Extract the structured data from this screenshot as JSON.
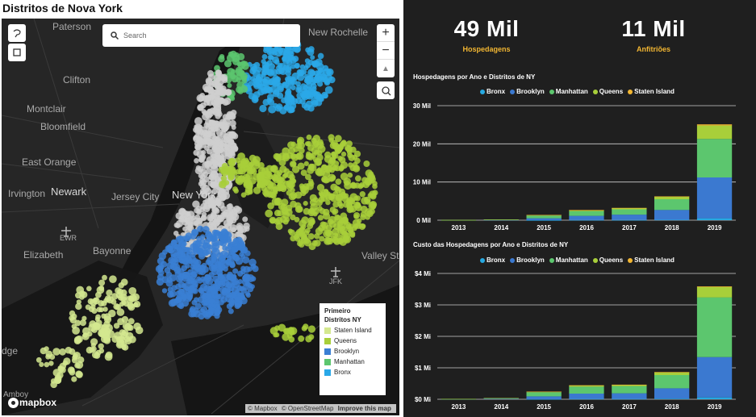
{
  "map": {
    "title": "Distritos de Nova York",
    "search_placeholder": "Search",
    "zoom_in": "+",
    "zoom_out": "−",
    "compass": "▲",
    "labels": {
      "paterson": "Paterson",
      "new_rochelle": "New Rochelle",
      "clifton": "Clifton",
      "montclair": "Montclair",
      "bloomfield": "Bloomfield",
      "east_orange": "East Orange",
      "irvington": "Irvington",
      "newark": "Newark",
      "jersey_city": "Jersey City",
      "new_york": "New York",
      "ewr": "EWR",
      "elizabeth": "Elizabeth",
      "bayonne": "Bayonne",
      "jfk": "JFK",
      "valley_stre": "Valley Stre",
      "dge": "dge",
      "amboy": "Amboy"
    },
    "legend": {
      "header1": "Primeiro",
      "header2": "Distritos NY",
      "items": [
        {
          "label": "Staten Island",
          "color": "#d4e88f"
        },
        {
          "label": "Queens",
          "color": "#a8cf3a"
        },
        {
          "label": "Brooklyn",
          "color": "#3a7fd4"
        },
        {
          "label": "Manhattan",
          "color": "#5cc66e"
        },
        {
          "label": "Bronx",
          "color": "#2aa8e8"
        }
      ]
    },
    "attribution": {
      "mapbox": "© Mapbox",
      "osm": "© OpenStreetMap",
      "improve": "Improve this map"
    },
    "logo": "mapbox"
  },
  "kpis": [
    {
      "value": "49 Mil",
      "label": "Hospedagens"
    },
    {
      "value": "11 Mil",
      "label": "Anfitriões"
    }
  ],
  "colors": {
    "Bronx": "#27a9e1",
    "Brooklyn": "#3b79d0",
    "Manhattan": "#5cc66e",
    "Queens": "#a8cf3a",
    "Staten Island": "#f2b632"
  },
  "chart_data": [
    {
      "type": "bar",
      "stacked": true,
      "title": "Hospedagens por Ano e Distritos de  NY",
      "categories": [
        "2013",
        "2014",
        "2015",
        "2016",
        "2017",
        "2018",
        "2019"
      ],
      "series": [
        {
          "name": "Bronx",
          "values": [
            0,
            0,
            10,
            40,
            50,
            100,
            500
          ]
        },
        {
          "name": "Brooklyn",
          "values": [
            20,
            70,
            500,
            1100,
            1400,
            2600,
            10700
          ]
        },
        {
          "name": "Manhattan",
          "values": [
            30,
            90,
            700,
            1200,
            1400,
            2800,
            10100
          ]
        },
        {
          "name": "Queens",
          "values": [
            10,
            20,
            150,
            300,
            350,
            700,
            3500
          ]
        },
        {
          "name": "Staten Island",
          "values": [
            0,
            0,
            10,
            20,
            20,
            40,
            300
          ]
        }
      ],
      "y_ticks": [
        "0 Mil",
        "10 Mil",
        "20 Mil",
        "30 Mil"
      ],
      "ylim": [
        0,
        30000
      ]
    },
    {
      "type": "bar",
      "stacked": true,
      "title": "Custo das Hospedagens por Ano e Distritos de NY",
      "categories": [
        "2013",
        "2014",
        "2015",
        "2016",
        "2017",
        "2018",
        "2019"
      ],
      "series": [
        {
          "name": "Bronx",
          "values": [
            0,
            0,
            0.003,
            0.01,
            0.01,
            0.02,
            0.06
          ]
        },
        {
          "name": "Brooklyn",
          "values": [
            0.004,
            0.015,
            0.09,
            0.17,
            0.18,
            0.33,
            1.28
          ]
        },
        {
          "name": "Manhattan",
          "values": [
            0.006,
            0.02,
            0.13,
            0.22,
            0.23,
            0.42,
            1.9
          ]
        },
        {
          "name": "Queens",
          "values": [
            0.001,
            0.004,
            0.02,
            0.04,
            0.04,
            0.09,
            0.33
          ]
        },
        {
          "name": "Staten Island",
          "values": [
            0,
            0,
            0.001,
            0.003,
            0.003,
            0.005,
            0.02
          ]
        }
      ],
      "y_ticks": [
        "$0 Mi",
        "$1 Mi",
        "$2 Mi",
        "$3 Mi",
        "$4 Mi"
      ],
      "ylim": [
        0,
        4
      ]
    }
  ]
}
